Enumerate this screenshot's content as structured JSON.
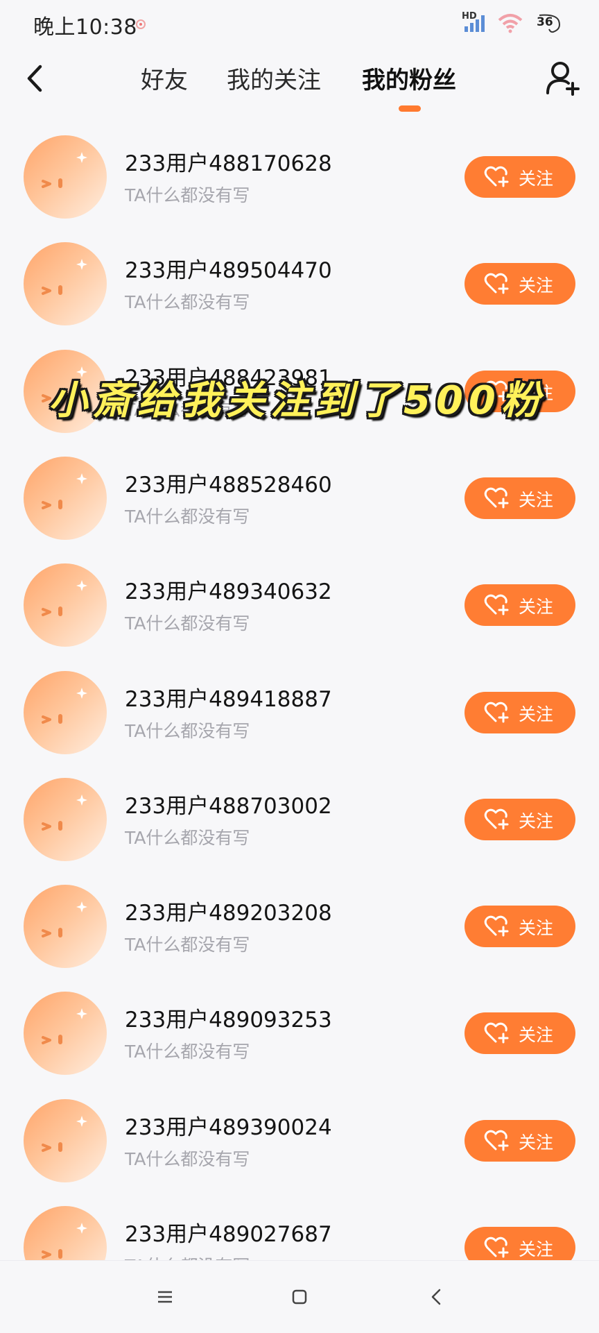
{
  "status_bar": {
    "time": "晚上10:38",
    "network_label": "HD",
    "battery": "36"
  },
  "nav": {
    "tabs": [
      {
        "label": "好友"
      },
      {
        "label": "我的关注"
      },
      {
        "label": "我的粉丝",
        "active": true
      }
    ]
  },
  "overlay": {
    "caption": "小斎给我关注到了500粉"
  },
  "fans": [
    {
      "name": "233用户488170628",
      "bio": "TA什么都没有写",
      "button": "关注"
    },
    {
      "name": "233用户489504470",
      "bio": "TA什么都没有写",
      "button": "关注"
    },
    {
      "name": "233用户488423981",
      "bio": "TA什么都没有写",
      "button": "关注"
    },
    {
      "name": "233用户488528460",
      "bio": "TA什么都没有写",
      "button": "关注"
    },
    {
      "name": "233用户489340632",
      "bio": "TA什么都没有写",
      "button": "关注"
    },
    {
      "name": "233用户489418887",
      "bio": "TA什么都没有写",
      "button": "关注"
    },
    {
      "name": "233用户488703002",
      "bio": "TA什么都没有写",
      "button": "关注"
    },
    {
      "name": "233用户489203208",
      "bio": "TA什么都没有写",
      "button": "关注"
    },
    {
      "name": "233用户489093253",
      "bio": "TA什么都没有写",
      "button": "关注"
    },
    {
      "name": "233用户489390024",
      "bio": "TA什么都没有写",
      "button": "关注"
    },
    {
      "name": "233用户489027687",
      "bio": "TA什么都没有写",
      "button": "关注"
    }
  ],
  "colors": {
    "accent": "#ff7d33",
    "background": "#f7f7f9",
    "caption_yellow": "#fff15a"
  },
  "icons": {
    "back": "chevron-left-icon",
    "add_user": "add-user-icon",
    "follow": "heart-plus-icon",
    "bottom_nav": [
      "menu-icon",
      "home-square-icon",
      "back-triangle-icon"
    ]
  }
}
